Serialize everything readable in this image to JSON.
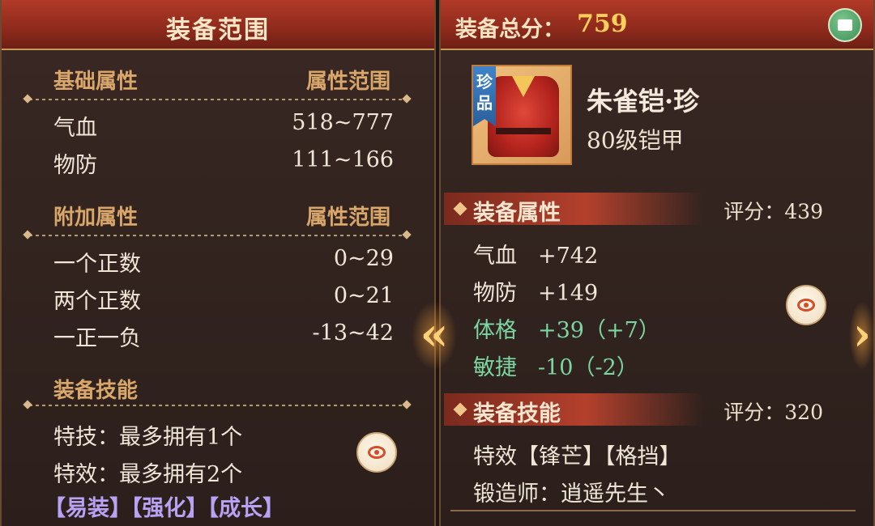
{
  "left": {
    "title": "装备范围",
    "base_section": "基础属性",
    "base_range_head": "属性范围",
    "base_rows": [
      {
        "label": "气血",
        "value": "518~777"
      },
      {
        "label": "物防",
        "value": "111~166"
      }
    ],
    "extra_section": "附加属性",
    "extra_range_head": "属性范围",
    "extra_rows": [
      {
        "label": "一个正数",
        "value": "0~29"
      },
      {
        "label": "两个正数",
        "value": "0~21"
      },
      {
        "label": "一正一负",
        "value": "-13~42"
      }
    ],
    "skill_section": "装备技能",
    "skill_lines": [
      "特技：最多拥有1个",
      "特效：最多拥有2个"
    ],
    "tags": "【易装】【强化】【成长】"
  },
  "right": {
    "score_label": "装备总分：",
    "score_value": "759",
    "item": {
      "rarity_tag": "珍品",
      "name": "朱雀铠·珍",
      "type": "80级铠甲"
    },
    "attr_section": "装备属性",
    "attr_score": "评分：439",
    "attrs": [
      {
        "label": "气血",
        "value": "+742",
        "color": "#f0e6d8"
      },
      {
        "label": "物防",
        "value": "+149",
        "color": "#f0e6d8"
      },
      {
        "label": "体格",
        "value": "+39（+7）",
        "color": "#7bd6a1"
      },
      {
        "label": "敏捷",
        "value": "-10（-2）",
        "color": "#7bd6a1"
      }
    ],
    "skill_section": "装备技能",
    "skill_score": "评分：320",
    "effects": "特效【锋芒】【格挡】",
    "forger": "锻造师：逍遥先生丶"
  },
  "icons": {
    "share": "share-icon",
    "view": "eye-icon",
    "prev": "double-chevron-left-icon",
    "next": "chevron-right-icon"
  }
}
